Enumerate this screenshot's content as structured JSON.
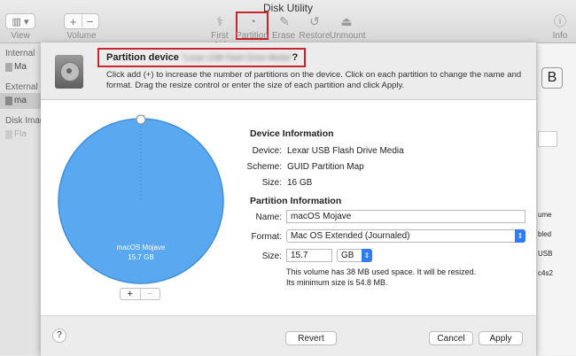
{
  "window": {
    "title": "Disk Utility"
  },
  "toolbar": {
    "view_label": "View",
    "volume_label": "Volume",
    "first_aid_label": "First Aid",
    "partition_label": "Partition",
    "erase_label": "Erase",
    "restore_label": "Restore",
    "unmount_label": "Unmount",
    "info_label": "Info",
    "add_symbol": "+",
    "remove_symbol": "−"
  },
  "sidebar": {
    "internal_header": "Internal",
    "internal_item": "Ma",
    "external_header": "External",
    "external_item": "ma",
    "images_header": "Disk Image",
    "images_item": "Fla"
  },
  "background_right": {
    "fragments": [
      "B",
      "ume",
      "bled",
      "USB",
      "c4s2"
    ]
  },
  "sheet": {
    "title_prefix": "Partition device",
    "title_device": "“Lexar USB Flash Drive Media”",
    "title_suffix": "?",
    "instructions": "Click add (+) to increase the number of partitions on the device. Click on each partition to change the name and format. Drag the resize control or enter the size of each partition and click Apply.",
    "pie": {
      "partition_name": "macOS Mojave",
      "partition_size": "15.7 GB",
      "color": "#5aa9f0",
      "fraction": 1.0,
      "add_label": "+",
      "remove_label": "−"
    },
    "device_info": {
      "header": "Device Information",
      "device_label": "Device:",
      "device_value": "Lexar USB Flash Drive Media",
      "scheme_label": "Scheme:",
      "scheme_value": "GUID Partition Map",
      "size_label": "Size:",
      "size_value": "16 GB"
    },
    "partition_info": {
      "header": "Partition Information",
      "name_label": "Name:",
      "name_value": "macOS Mojave",
      "format_label": "Format:",
      "format_value": "Mac OS Extended (Journaled)",
      "size_label": "Size:",
      "size_value": "15.7",
      "unit_value": "GB",
      "note_line1": "This volume has 38 MB used space. It will be resized.",
      "note_line2": "Its minimum size is 54.8 MB."
    },
    "footer": {
      "help_label": "?",
      "revert_label": "Revert",
      "cancel_label": "Cancel",
      "apply_label": "Apply"
    }
  },
  "colors": {
    "accent": "#2f7cf6",
    "highlight_box": "#c8242b",
    "pie_fill": "#5aa9f0"
  }
}
